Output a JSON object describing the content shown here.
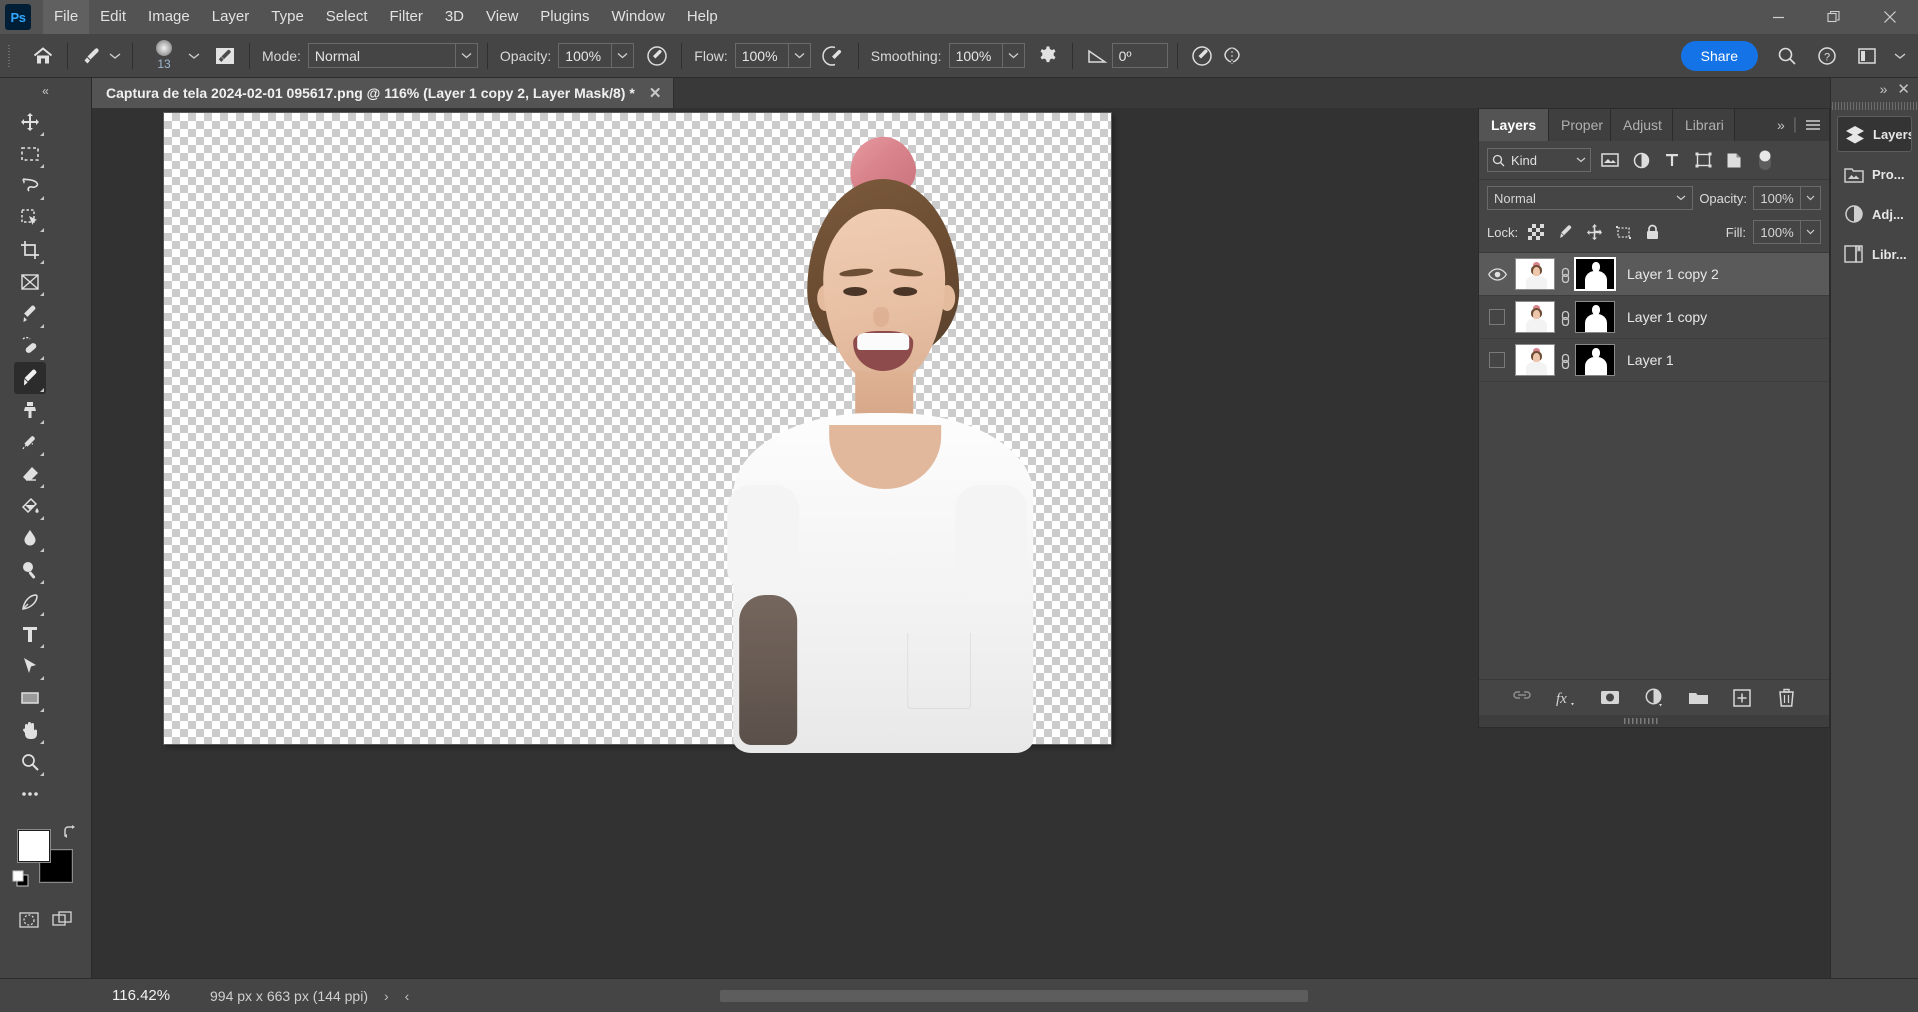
{
  "app": {
    "name": "Photoshop",
    "logo_text": "Ps"
  },
  "menubar": {
    "items": [
      {
        "label": "File"
      },
      {
        "label": "Edit"
      },
      {
        "label": "Image"
      },
      {
        "label": "Layer"
      },
      {
        "label": "Type"
      },
      {
        "label": "Select"
      },
      {
        "label": "Filter"
      },
      {
        "label": "3D"
      },
      {
        "label": "View"
      },
      {
        "label": "Plugins"
      },
      {
        "label": "Window"
      },
      {
        "label": "Help"
      }
    ]
  },
  "window_controls": {
    "minimize": "—",
    "restore": "❐",
    "close": "✕"
  },
  "options_bar": {
    "home_icon": "home-icon",
    "brush_preset_icon": "brush-preset-icon",
    "brush_size": "13",
    "brush_settings_icon": "brush-settings-panel-icon",
    "mode_label": "Mode:",
    "mode_value": "Normal",
    "opacity_label": "Opacity:",
    "opacity_value": "100%",
    "pressure_opacity_icon": "pressure-opacity-icon",
    "flow_label": "Flow:",
    "flow_value": "100%",
    "airbrush_icon": "airbrush-icon",
    "smoothing_label": "Smoothing:",
    "smoothing_value": "100%",
    "gear_icon": "smoothing-options-gear-icon",
    "angle_icon": "brush-angle-icon",
    "angle_value": "0º",
    "tablet_pressure_icon": "tablet-pressure-size-icon",
    "symmetry_icon": "paint-symmetry-icon",
    "share_label": "Share",
    "search_icon": "search-icon",
    "help_icon": "help-icon",
    "workspace_icon": "workspace-switcher-icon",
    "more_icon": "chevron-down-icon"
  },
  "document_tab": {
    "title": "Captura de tela 2024-02-01 095617.png @ 116% (Layer 1 copy 2, Layer Mask/8) *",
    "close_icon": "close-icon"
  },
  "toolbar": {
    "collapse_icon": "«",
    "tools": [
      {
        "name": "move-tool",
        "icon": "move"
      },
      {
        "name": "rectangular-marquee-tool",
        "icon": "marquee"
      },
      {
        "name": "lasso-tool",
        "icon": "lasso"
      },
      {
        "name": "object-selection-tool",
        "icon": "quick-select"
      },
      {
        "name": "crop-tool",
        "icon": "crop"
      },
      {
        "name": "frame-tool",
        "icon": "frame"
      },
      {
        "name": "eyedropper-tool",
        "icon": "eyedropper"
      },
      {
        "name": "spot-healing-brush-tool",
        "icon": "healing"
      },
      {
        "name": "brush-tool",
        "icon": "brush",
        "active": true
      },
      {
        "name": "clone-stamp-tool",
        "icon": "stamp"
      },
      {
        "name": "history-brush-tool",
        "icon": "history-brush"
      },
      {
        "name": "eraser-tool",
        "icon": "eraser"
      },
      {
        "name": "gradient-tool",
        "icon": "paint-bucket"
      },
      {
        "name": "blur-tool",
        "icon": "blur-drop"
      },
      {
        "name": "dodge-tool",
        "icon": "dodge"
      },
      {
        "name": "pen-tool",
        "icon": "pen"
      },
      {
        "name": "horizontal-type-tool",
        "icon": "type"
      },
      {
        "name": "path-selection-tool",
        "icon": "path-select"
      },
      {
        "name": "rectangle-tool",
        "icon": "rectangle"
      },
      {
        "name": "hand-tool",
        "icon": "hand"
      },
      {
        "name": "zoom-tool",
        "icon": "zoom"
      },
      {
        "name": "edit-toolbar-tool",
        "icon": "ellipsis"
      }
    ],
    "foreground_color": "#ffffff",
    "background_color": "#000000",
    "swap_colors_icon": "swap-colors-icon",
    "default_colors_icon": "default-colors-icon",
    "quick_mask_icon": "quick-mask-icon",
    "screen_mode_icon": "screen-mode-icon"
  },
  "layers_panel": {
    "tabs": [
      {
        "label": "Layers",
        "active": true
      },
      {
        "label": "Proper",
        "active": false
      },
      {
        "label": "Adjust",
        "active": false
      },
      {
        "label": "Librari",
        "active": false
      }
    ],
    "expand_icon": "»",
    "menu_icon": "panel-menu-icon",
    "filter": {
      "search_icon": "search-icon",
      "kind_label": "Kind",
      "chevron": "chevron-down-icon",
      "toggles": [
        {
          "name": "filter-pixel-layers-icon"
        },
        {
          "name": "filter-adjustment-layers-icon"
        },
        {
          "name": "filter-type-layers-icon"
        },
        {
          "name": "filter-shape-layers-icon"
        },
        {
          "name": "filter-smart-objects-icon"
        }
      ],
      "power_toggle": "filter-power-toggle"
    },
    "blend_mode": "Normal",
    "opacity_label": "Opacity:",
    "opacity_value": "100%",
    "lock_label": "Lock:",
    "lock_icons": [
      {
        "name": "lock-transparent-pixels-icon"
      },
      {
        "name": "lock-image-pixels-icon"
      },
      {
        "name": "lock-position-icon"
      },
      {
        "name": "lock-artboard-nesting-icon"
      },
      {
        "name": "lock-all-icon"
      }
    ],
    "fill_label": "Fill:",
    "fill_value": "100%",
    "layers": [
      {
        "name": "Layer 1 copy 2",
        "visible": true,
        "selected": true,
        "mask_active": true,
        "linked": true
      },
      {
        "name": "Layer 1 copy",
        "visible": false,
        "selected": false,
        "mask_active": false,
        "linked": true
      },
      {
        "name": "Layer 1",
        "visible": false,
        "selected": false,
        "mask_active": false,
        "linked": true
      }
    ],
    "footer_icons": [
      {
        "name": "link-layers-icon"
      },
      {
        "name": "layer-styles-fx-icon"
      },
      {
        "name": "add-layer-mask-icon"
      },
      {
        "name": "new-adjustment-layer-icon"
      },
      {
        "name": "new-group-icon"
      },
      {
        "name": "new-layer-icon"
      },
      {
        "name": "delete-layer-icon"
      }
    ]
  },
  "icon_dock": {
    "collapse_icon": "»",
    "close_icon": "✕",
    "items": [
      {
        "label": "Layers",
        "icon": "layers-icon",
        "active": true
      },
      {
        "label": "Pro...",
        "icon": "properties-icon",
        "active": false
      },
      {
        "label": "Adj...",
        "icon": "adjustments-icon",
        "active": false
      },
      {
        "label": "Libr...",
        "icon": "libraries-icon",
        "active": false
      }
    ]
  },
  "status_bar": {
    "zoom_level": "116.42%",
    "document_size": "994 px x 663 px (144 ppi)",
    "next_arrow": "›",
    "prev_arrow": "‹"
  },
  "colors": {
    "accent_blue": "#1473e6",
    "panel_bg": "#454545",
    "canvas_bg": "#323232",
    "titlebar_bg": "#535353",
    "selected_layer": "#5a5a5a"
  }
}
